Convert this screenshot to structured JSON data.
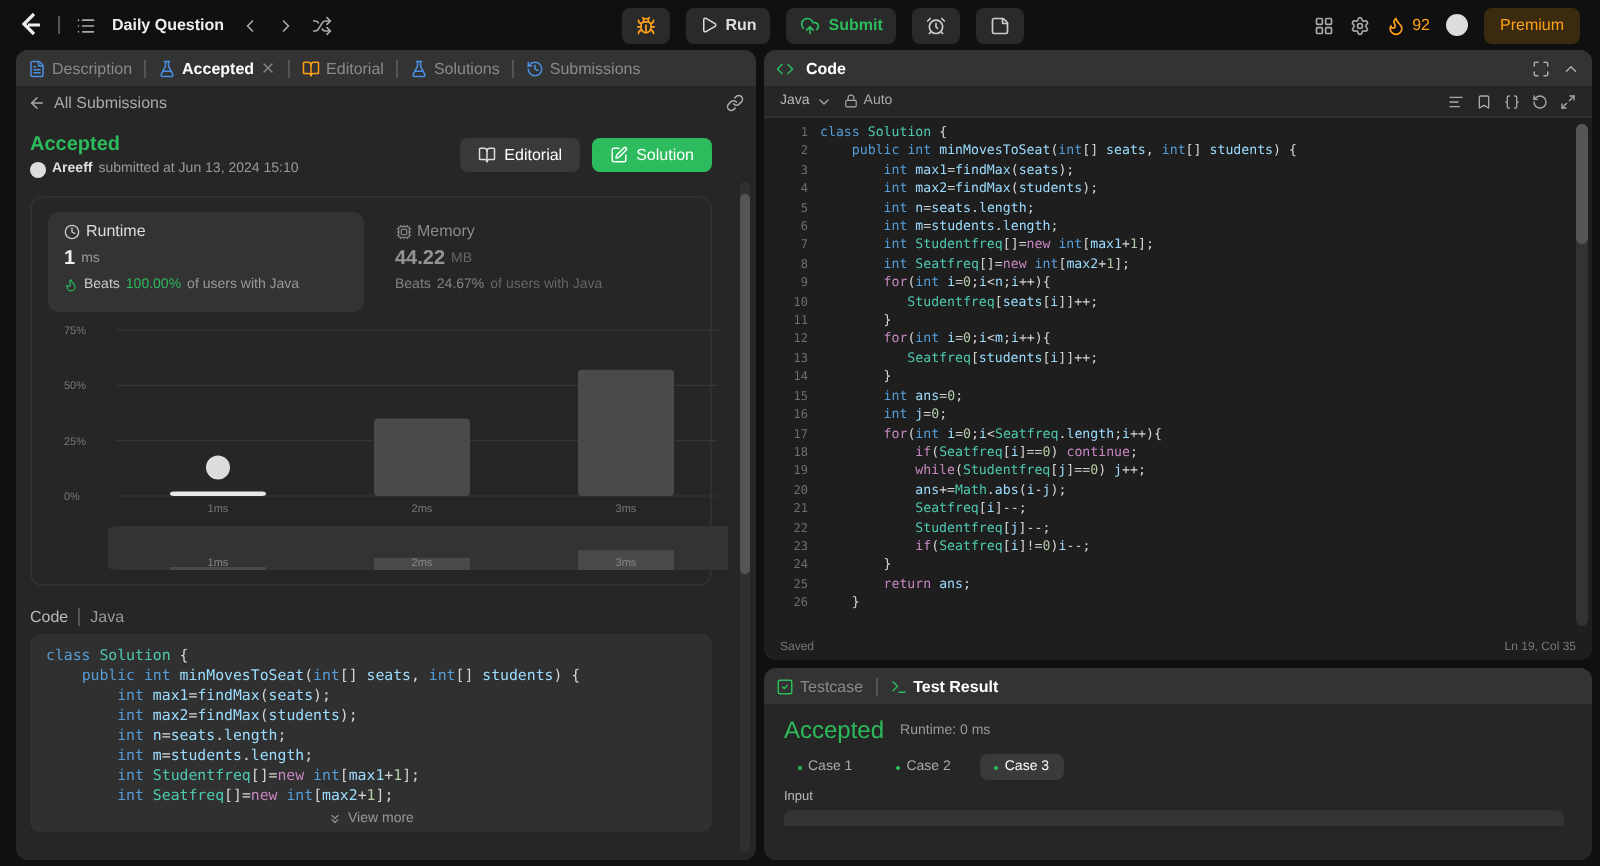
{
  "top_bar": {
    "title": "Daily Question",
    "run": "Run",
    "submit": "Submit",
    "streak": "92",
    "premium": "Premium"
  },
  "left_tabs": [
    {
      "label": "Description",
      "selected": false,
      "kind": "description"
    },
    {
      "label": "Accepted",
      "selected": true,
      "kind": "accepted",
      "closable": true
    },
    {
      "label": "Editorial",
      "selected": false,
      "kind": "editorial"
    },
    {
      "label": "Solutions",
      "selected": false,
      "kind": "solutions"
    },
    {
      "label": "Submissions",
      "selected": false,
      "kind": "submissions"
    }
  ],
  "back_link": "All Submissions",
  "submission": {
    "status": "Accepted",
    "user": "Areeff",
    "submitted": "submitted at Jun 13, 2024 15:10",
    "editorial_button": "Editorial",
    "solution_button": "Solution"
  },
  "stats": [
    {
      "kind": "runtime",
      "title": "Runtime",
      "value": "1",
      "unit": "ms",
      "beats": "Beats",
      "percent": "100.00%",
      "suffix": "of users with Java",
      "selected": true
    },
    {
      "kind": "memory",
      "title": "Memory",
      "value": "44.22",
      "unit": "MB",
      "beats": "Beats",
      "percent": "24.67%",
      "suffix": "of users with Java",
      "selected": false
    }
  ],
  "chart_data": {
    "type": "bar",
    "categories": [
      "1ms",
      "2ms",
      "3ms"
    ],
    "values": [
      2,
      35,
      57
    ],
    "ylim": [
      0,
      75
    ],
    "yticks": [
      {
        "value": 0,
        "label": "0%"
      },
      {
        "value": 25,
        "label": "25%"
      },
      {
        "value": 50,
        "label": "50%"
      },
      {
        "value": 75,
        "label": "75%"
      }
    ],
    "annotations": [
      {
        "x": "1ms"
      }
    ]
  },
  "navigator": {
    "labels": [
      "1ms",
      "2ms",
      "3ms"
    ]
  },
  "code_preview": {
    "title": "Code",
    "language": "Java",
    "lines": [
      "class Solution {",
      "    public int minMovesToSeat(int[] seats, int[] students) {",
      "        int max1=findMax(seats);",
      "        int max2=findMax(students);",
      "        int n=seats.length;",
      "        int m=students.length;",
      "        int Studentfreq[]=new int[max1+1];",
      "        int Seatfreq[]=new int[max2+1];"
    ],
    "more": "View more"
  },
  "editor": {
    "title": "Code",
    "language": "Java",
    "mode": "Auto",
    "lines": [
      "class Solution {",
      "    public int minMovesToSeat(int[] seats, int[] students) {",
      "        int max1=findMax(seats);",
      "        int max2=findMax(students);",
      "        int n=seats.length;",
      "        int m=students.length;",
      "        int Studentfreq[]=new int[max1+1];",
      "        int Seatfreq[]=new int[max2+1];",
      "        for(int i=0;i<n;i++){",
      "           Studentfreq[seats[i]]++;",
      "        }",
      "        for(int i=0;i<m;i++){",
      "           Seatfreq[students[i]]++;",
      "        }",
      "        int ans=0;",
      "        int j=0;",
      "        for(int i=0;i<Seatfreq.length;i++){",
      "            if(Seatfreq[i]==0) continue;",
      "            while(Studentfreq[j]==0) j++;",
      "            ans+=Math.abs(i-j);",
      "            Seatfreq[i]--;",
      "            Studentfreq[j]--;",
      "            if(Seatfreq[i]!=0)i--;",
      "        }",
      "        return ans;",
      "    }"
    ],
    "line_numbers": [
      "1",
      "2",
      "3",
      "4",
      "5",
      "6",
      "7",
      "8",
      "9",
      "10",
      "11",
      "12",
      "13",
      "14",
      "15",
      "16",
      "17",
      "18",
      "19",
      "20",
      "21",
      "22",
      "23",
      "24",
      "25",
      "26"
    ],
    "saved": "Saved",
    "cursor": "Ln 19, Col 35"
  },
  "test_tabs": [
    {
      "label": "Testcase",
      "selected": false,
      "kind": "testcase"
    },
    {
      "label": "Test Result",
      "selected": true,
      "kind": "result"
    }
  ],
  "result": {
    "status": "Accepted",
    "runtime": "Runtime: 0 ms",
    "input_label": "Input"
  },
  "cases": [
    {
      "label": "Case 1",
      "selected": false
    },
    {
      "label": "Case 2",
      "selected": false
    },
    {
      "label": "Case 3",
      "selected": true
    }
  ]
}
